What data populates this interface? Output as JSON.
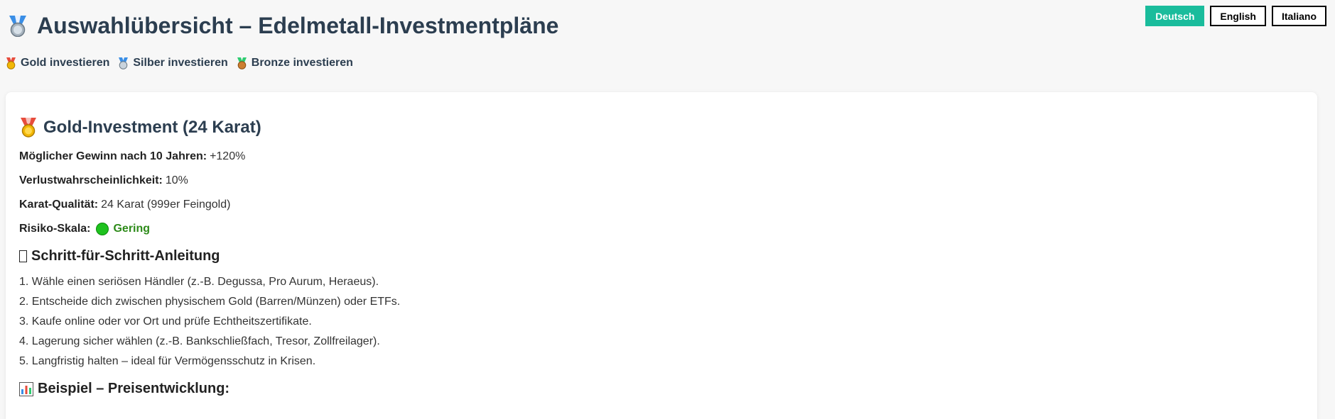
{
  "header": {
    "title": "Auswahlübersicht – Edelmetall-Investmentpläne",
    "title_icon": "silver-medal-icon"
  },
  "languages": [
    {
      "label": "Deutsch",
      "active": true
    },
    {
      "label": "English",
      "active": false
    },
    {
      "label": "Italiano",
      "active": false
    }
  ],
  "nav": {
    "items": [
      {
        "label": "Gold investieren",
        "icon": "gold-medal-icon"
      },
      {
        "label": "Silber investieren",
        "icon": "silver-medal-icon"
      },
      {
        "label": "Bronze investieren",
        "icon": "bronze-medal-icon"
      }
    ]
  },
  "card": {
    "title": "Gold-Investment (24 Karat)",
    "title_icon": "gold-medal-icon",
    "fields": [
      {
        "label": "Möglicher Gewinn nach 10 Jahren:",
        "value": "+120%"
      },
      {
        "label": "Verlustwahrscheinlichkeit:",
        "value": "10%"
      },
      {
        "label": "Karat-Qualität:",
        "value": "24 Karat (999er Feingold)"
      }
    ],
    "risk": {
      "label": "Risiko-Skala:",
      "value": "Gering",
      "color": "#2e8b1a",
      "dot_color": "#1fc21f"
    },
    "guide_heading": "Schritt-für-Schritt-Anleitung",
    "steps": [
      "Wähle einen seriösen Händler (z.-B. Degussa, Pro Aurum, Heraeus).",
      "Entscheide dich zwischen physischem Gold (Barren/Münzen) oder ETFs.",
      "Kaufe online oder vor Ort und prüfe Echtheitszertifikate.",
      "Lagerung sicher wählen (z.-B. Bankschließfach, Tresor, Zollfreilager).",
      "Langfristig halten – ideal für Vermögensschutz in Krisen."
    ],
    "chart_heading": "Beispiel – Preisentwicklung:",
    "chart_icon": "bar-chart-icon"
  },
  "colors": {
    "accent": "#1abc9c",
    "heading": "#2c3e50",
    "gold": "#f2b705",
    "silver": "#c9d3dc",
    "bronze": "#cd7f32",
    "ribbon_red": "#e74c3c",
    "ribbon_blue": "#3a8ee6",
    "ribbon_green": "#2ecc71"
  }
}
